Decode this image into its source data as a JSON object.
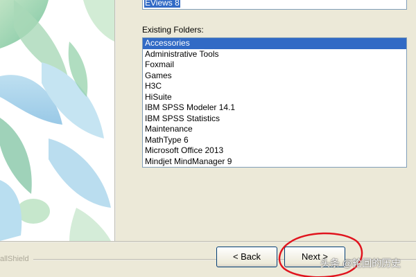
{
  "program_folder": {
    "value": "EViews 8"
  },
  "existing_folders": {
    "label": "Existing Folders:",
    "items": [
      "Accessories",
      "Administrative Tools",
      "Foxmail",
      "Games",
      "H3C",
      "HiSuite",
      "IBM SPSS Modeler 14.1",
      "IBM SPSS Statistics",
      "Maintenance",
      "MathType 6",
      "Microsoft Office 2013",
      "Mindjet MindManager 9"
    ],
    "selected_index": 0
  },
  "footer": {
    "brand": "allShield",
    "back_label": "< Back",
    "next_label": "Next >"
  },
  "watermark": "头条 @轮回的历史",
  "colors": {
    "selection": "#316ac5",
    "annotation_circle": "#e0141e",
    "window_bg": "#ece9d8"
  }
}
